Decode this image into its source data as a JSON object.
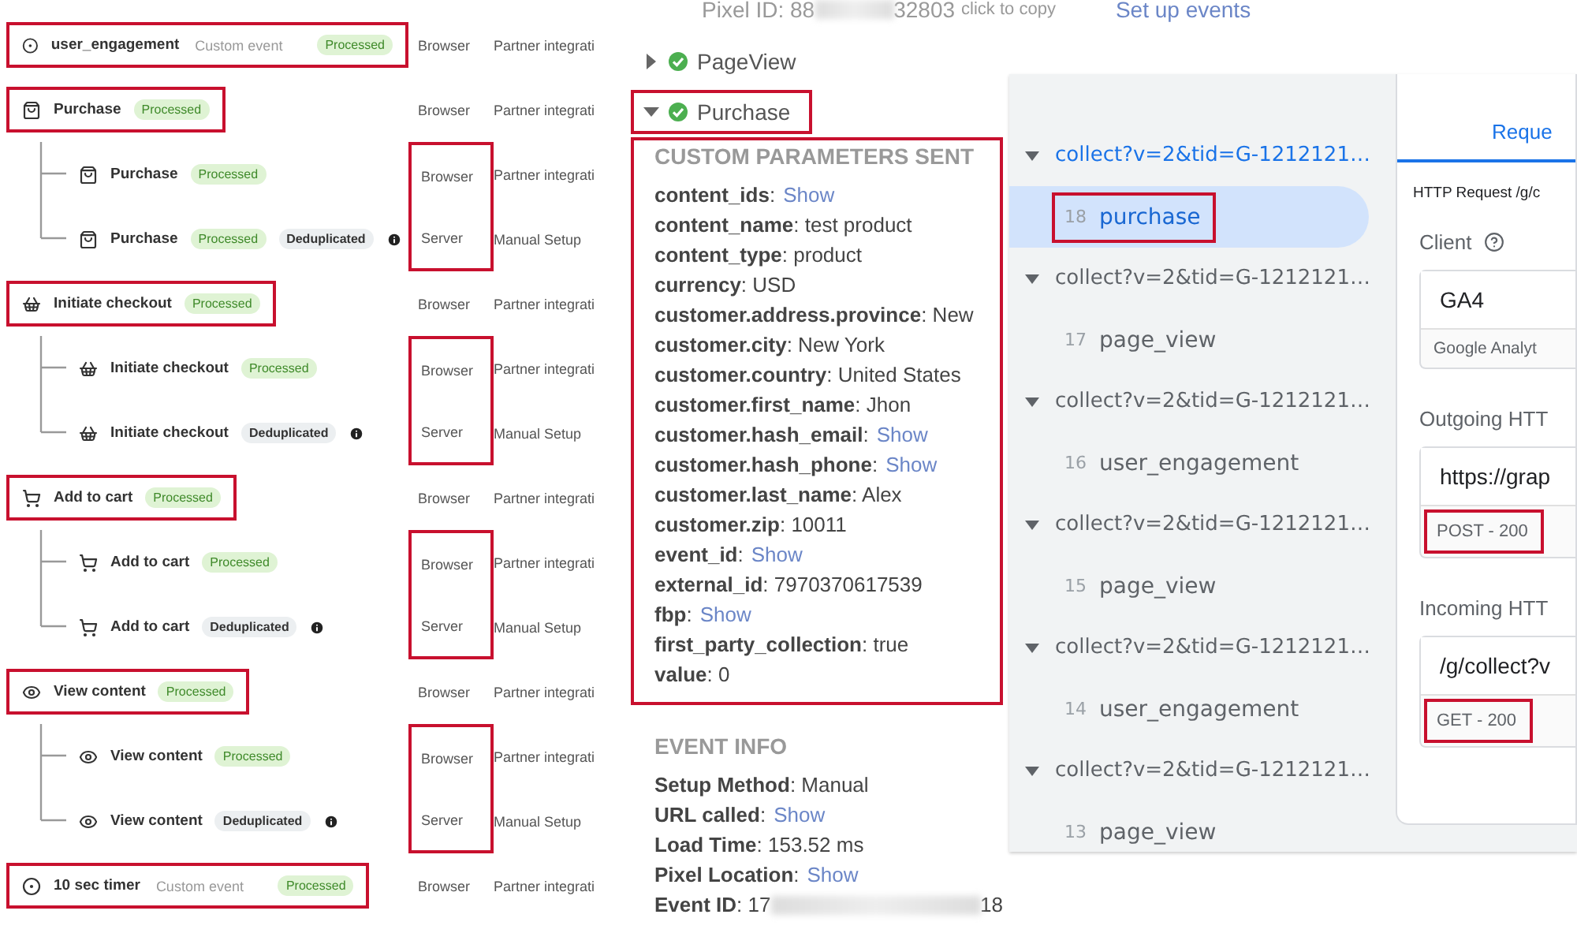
{
  "events_panel": {
    "events": [
      {
        "kind": "custom",
        "name": "user_engagement",
        "tag": "Custom event",
        "status": {
          "kind": "processed",
          "label": "Processed"
        },
        "source": "Browser",
        "setup": "Partner integrati",
        "highlighted": true
      },
      {
        "kind": "purchase",
        "name": "Purchase",
        "status": {
          "kind": "processed",
          "label": "Processed"
        },
        "source": "Browser",
        "setup": "Partner integrati",
        "highlighted": true,
        "sources_highlighted": true,
        "children": [
          {
            "kind": "purchase",
            "name": "Purchase",
            "status": {
              "kind": "processed",
              "label": "Processed"
            },
            "source": "Browser",
            "setup": "Partner integrati"
          },
          {
            "kind": "purchase",
            "name": "Purchase",
            "status": {
              "kind": "processed",
              "label": "Processed"
            },
            "extra": {
              "kind": "deduplicated",
              "label": "Deduplicated"
            },
            "source": "Server",
            "setup": "Manual Setup"
          }
        ]
      },
      {
        "kind": "checkout",
        "name": "Initiate checkout",
        "status": {
          "kind": "processed",
          "label": "Processed"
        },
        "source": "Browser",
        "setup": "Partner integrati",
        "highlighted": true,
        "sources_highlighted": true,
        "children": [
          {
            "kind": "checkout",
            "name": "Initiate checkout",
            "status": {
              "kind": "processed",
              "label": "Processed"
            },
            "source": "Browser",
            "setup": "Partner integrati"
          },
          {
            "kind": "checkout",
            "name": "Initiate checkout",
            "status": {
              "kind": "deduplicated",
              "label": "Deduplicated"
            },
            "source": "Server",
            "setup": "Manual Setup"
          }
        ]
      },
      {
        "kind": "cart",
        "name": "Add to cart",
        "status": {
          "kind": "processed",
          "label": "Processed"
        },
        "source": "Browser",
        "setup": "Partner integrati",
        "highlighted": true,
        "sources_highlighted": true,
        "children": [
          {
            "kind": "cart",
            "name": "Add to cart",
            "status": {
              "kind": "processed",
              "label": "Processed"
            },
            "source": "Browser",
            "setup": "Partner integrati"
          },
          {
            "kind": "cart",
            "name": "Add to cart",
            "status": {
              "kind": "deduplicated",
              "label": "Deduplicated"
            },
            "source": "Server",
            "setup": "Manual Setup"
          }
        ]
      },
      {
        "kind": "view",
        "name": "View content",
        "status": {
          "kind": "processed",
          "label": "Processed"
        },
        "source": "Browser",
        "setup": "Partner integrati",
        "highlighted": true,
        "sources_highlighted": true,
        "children": [
          {
            "kind": "view",
            "name": "View content",
            "status": {
              "kind": "processed",
              "label": "Processed"
            },
            "source": "Browser",
            "setup": "Partner integrati"
          },
          {
            "kind": "view",
            "name": "View content",
            "status": {
              "kind": "deduplicated",
              "label": "Deduplicated"
            },
            "source": "Server",
            "setup": "Manual Setup"
          }
        ]
      },
      {
        "kind": "custom",
        "name": "10 sec timer",
        "tag": "Custom event",
        "status": {
          "kind": "processed",
          "label": "Processed"
        },
        "source": "Browser",
        "setup": "Partner integrati",
        "highlighted": true
      }
    ]
  },
  "pixel_helper": {
    "pixel_id": "Pixel ID: 88",
    "pixel_id_end": "32803",
    "copy_hint": "click to copy",
    "setup_link": "Set up events",
    "events": [
      {
        "name": "PageView",
        "expanded": false,
        "highlighted": false
      },
      {
        "name": "Purchase",
        "expanded": true,
        "highlighted": true
      }
    ],
    "custom_parameters": {
      "title": "CUSTOM PARAMETERS SENT",
      "highlighted": true,
      "params": [
        {
          "kind": "link",
          "key": "**content_ids**:",
          "value": "Show"
        },
        {
          "kind": "text",
          "text": "**content_name**: test product"
        },
        {
          "kind": "text",
          "text": "**content_type**: product"
        },
        {
          "kind": "text",
          "text": "**currency**: USD"
        },
        {
          "kind": "text",
          "text": "**customer.address.province**: New"
        },
        {
          "kind": "text",
          "text": "**customer.city**: New York"
        },
        {
          "kind": "text",
          "text": "**customer.country**: United States"
        },
        {
          "kind": "text",
          "text": "**customer.first_name**: Jhon"
        },
        {
          "kind": "link",
          "key": "**customer.hash_email**:",
          "value": "Show"
        },
        {
          "kind": "link",
          "key": "**customer.hash_phone**:",
          "value": "Show"
        },
        {
          "kind": "text",
          "text": "**customer.last_name**: Alex"
        },
        {
          "kind": "text",
          "text": "**customer.zip**: 10011"
        },
        {
          "kind": "link",
          "key": "**event_id**:",
          "value": "Show"
        },
        {
          "kind": "text",
          "text": "**external_id**: 7970370617539"
        },
        {
          "kind": "link",
          "key": "**fbp**:",
          "value": "Show"
        },
        {
          "kind": "text",
          "text": "**first_party_collection**: true"
        },
        {
          "kind": "text",
          "text": "**value**: 0"
        }
      ]
    },
    "event_info": {
      "title": "EVENT INFO",
      "items": [
        {
          "kind": "text",
          "text": "**Setup Method**: Manual"
        },
        {
          "kind": "link",
          "key": "**URL called**:",
          "value": "Show"
        },
        {
          "kind": "text",
          "text": "**Load Time**: 153.52 ms"
        },
        {
          "kind": "link",
          "key": "**Pixel Location**:",
          "value": "Show"
        },
        {
          "kind": "redacted",
          "text": "**Event ID**: 17",
          "text_end": "18"
        }
      ]
    }
  },
  "tag_preview": {
    "requests": [
      {
        "url": "collect?v=2&tid=G-1212121…",
        "selected": true,
        "event": {
          "number": "18",
          "name": "purchase",
          "selected": true,
          "highlighted": true
        }
      },
      {
        "url": "collect?v=2&tid=G-1212121…",
        "selected": false,
        "event": {
          "number": "17",
          "name": "page_view",
          "selected": false,
          "highlighted": false
        }
      },
      {
        "url": "collect?v=2&tid=G-1212121…",
        "selected": false,
        "event": {
          "number": "16",
          "name": "user_engagement",
          "selected": false,
          "highlighted": false
        }
      },
      {
        "url": "collect?v=2&tid=G-1212121…",
        "selected": false,
        "event": {
          "number": "15",
          "name": "page_view",
          "selected": false,
          "highlighted": false
        }
      },
      {
        "url": "collect?v=2&tid=G-1212121…",
        "selected": false,
        "event": {
          "number": "14",
          "name": "user_engagement",
          "selected": false,
          "highlighted": false
        }
      },
      {
        "url": "collect?v=2&tid=G-1212121…",
        "selected": false,
        "event": {
          "number": "13",
          "name": "page_view",
          "selected": false,
          "highlighted": false
        }
      }
    ],
    "tab": {
      "label": "Reque",
      "selected": true
    },
    "http_request": "HTTP Request /g/c",
    "client": {
      "label": "Client",
      "value": "GA4",
      "sub": "Google Analyt"
    },
    "outgoing": {
      "label": "Outgoing HTT",
      "url": "https://grap",
      "status": "POST - 200",
      "highlighted": true
    },
    "incoming": {
      "label": "Incoming HTT",
      "url": "/g/collect?v",
      "status": "GET - 200",
      "highlighted": true
    }
  }
}
